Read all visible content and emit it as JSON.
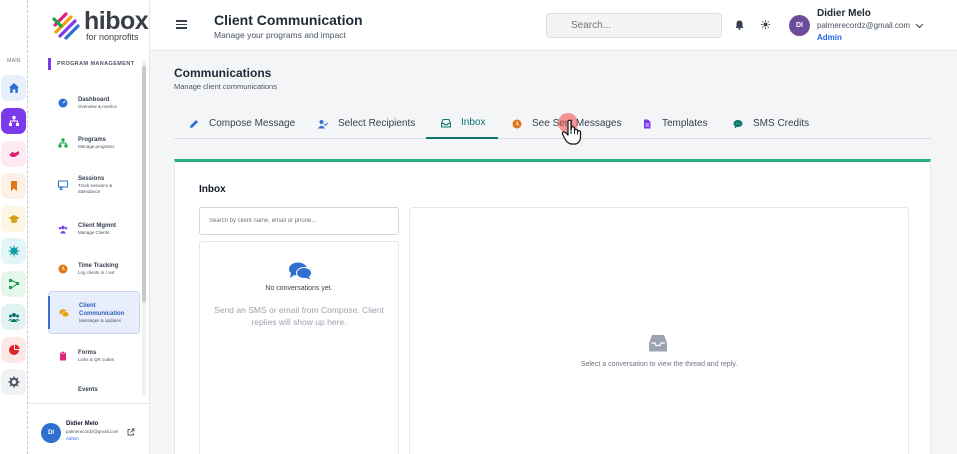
{
  "rail": {
    "label": "MAIN",
    "items": [
      {
        "name": "home",
        "icon": "home-icon",
        "color": "#2f6fcf",
        "bg": "#e8f0fb"
      },
      {
        "name": "programs",
        "icon": "network-icon",
        "color": "#ffffff",
        "bg": "#7c3aed"
      },
      {
        "name": "handshake",
        "icon": "handshake-icon",
        "color": "#e11d74",
        "bg": "#fdeaf2"
      },
      {
        "name": "bookmark",
        "icon": "bookmark-icon",
        "color": "#e0781a",
        "bg": "#fdf1e6"
      },
      {
        "name": "education",
        "icon": "graduation-cap-icon",
        "color": "#d4a012",
        "bg": "#fdf6e2"
      },
      {
        "name": "virus",
        "icon": "asterisk-icon",
        "color": "#0e9fa8",
        "bg": "#e2f6f7"
      },
      {
        "name": "diagram",
        "icon": "diagram-icon",
        "color": "#16a34a",
        "bg": "#e5f6ea"
      },
      {
        "name": "users",
        "icon": "users-icon",
        "color": "#0f766e",
        "bg": "#e2f3f1"
      },
      {
        "name": "reports",
        "icon": "pie-chart-icon",
        "color": "#dc2626",
        "bg": "#fde8e8"
      },
      {
        "name": "settings",
        "icon": "gear-icon",
        "color": "#4b5563",
        "bg": "#f1f2f4"
      }
    ]
  },
  "logo": {
    "main": "hibox",
    "sub": "for nonprofits"
  },
  "sidebar": {
    "section": "PROGRAM MANAGEMENT",
    "items": [
      {
        "title": "Dashboard",
        "sub": "Overview & metrics",
        "icon": "gauge-icon",
        "color": "#2f6fcf"
      },
      {
        "title": "Programs",
        "sub": "Manage programs",
        "icon": "network-icon",
        "color": "#16a34a"
      },
      {
        "title": "Sessions",
        "sub": "Track sessions &",
        "sub2": "attendance",
        "icon": "presentation-icon",
        "color": "#2f6fcf"
      },
      {
        "title": "Client Mgmnt",
        "sub": "Manage Clients",
        "icon": "users-icon",
        "color": "#7c3aed"
      },
      {
        "title": "Time Tracking",
        "sub": "Log clients in / out",
        "icon": "clock-icon",
        "color": "#e0781a"
      },
      {
        "title": "Client",
        "title2": "Communication",
        "sub": "Messages & updates",
        "icon": "comments-icon",
        "color": "#e0a512"
      },
      {
        "title": "Forms",
        "sub": "Links & QR codes",
        "icon": "clipboard-icon",
        "color": "#db2777"
      },
      {
        "title": "Events",
        "sub": "",
        "icon": "",
        "color": "#374151"
      }
    ],
    "user": {
      "initials": "DI",
      "name": "Didier Melo",
      "email": "palmerecordz@gmail.com",
      "role": "Admin"
    }
  },
  "header": {
    "title": "Client Communication",
    "subtitle": "Manage your programs and impact",
    "search_placeholder": "Search...",
    "user": {
      "initials": "DI",
      "name": "Didier Melo",
      "email": "palmerecordz@gmail.com",
      "role": "Admin"
    }
  },
  "page": {
    "title": "Communications",
    "subtitle": "Manage client communications",
    "tabs": [
      {
        "label": "Compose Message",
        "icon": "pencil-icon"
      },
      {
        "label": "Select Recipients",
        "icon": "user-check-icon"
      },
      {
        "label": "Inbox",
        "icon": "inbox-icon",
        "active": true
      },
      {
        "label": "See Sent Messages",
        "icon": "history-icon"
      },
      {
        "label": "Templates",
        "icon": "file-icon"
      },
      {
        "label": "SMS Credits",
        "icon": "sms-icon"
      }
    ]
  },
  "inbox": {
    "title": "Inbox",
    "search_placeholder": "Search by client name, email or phone...",
    "empty_title": "No conversations yet.",
    "empty_hint": "Send an SMS or email from Compose. Client replies will show up here.",
    "thread_hint": "Select a conversation to view the thread and reply."
  },
  "colors": {
    "accent": "#0f766e",
    "brand": "#7c3aed",
    "card_top": "#2ab07f",
    "link": "#2563eb"
  }
}
